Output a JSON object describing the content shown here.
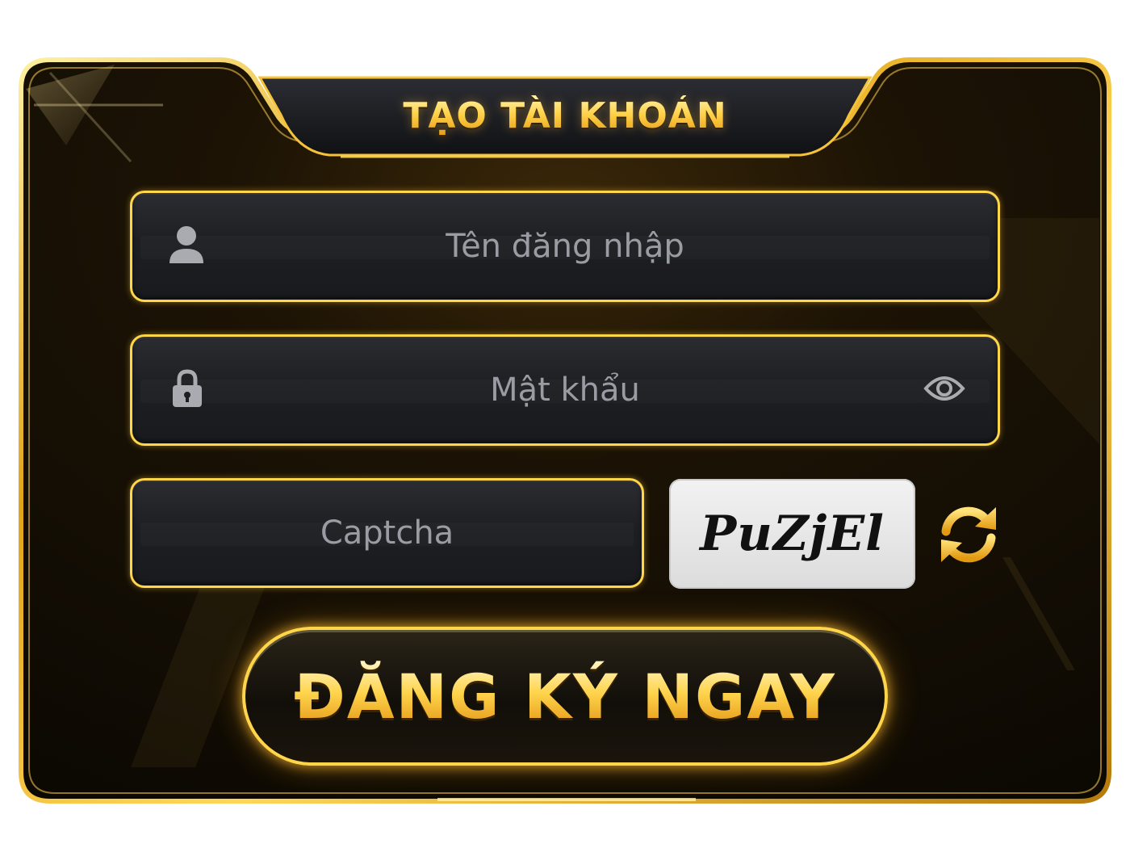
{
  "form": {
    "title": "TẠO TÀI KHOẢN",
    "username": {
      "placeholder": "Tên đăng nhập",
      "icon": "user-icon"
    },
    "password": {
      "placeholder": "Mật khẩu",
      "icon": "lock-icon",
      "toggle_icon": "eye-icon"
    },
    "captcha": {
      "placeholder": "Captcha",
      "code": "PuZjEl",
      "refresh_icon": "refresh-icon"
    },
    "submit_label": "ĐĂNG KÝ NGAY"
  },
  "colors": {
    "gold": "#ffd54a",
    "field_bg": "#1e1f23",
    "placeholder": "#9a9ca3",
    "panel_bg": "#120d05"
  }
}
